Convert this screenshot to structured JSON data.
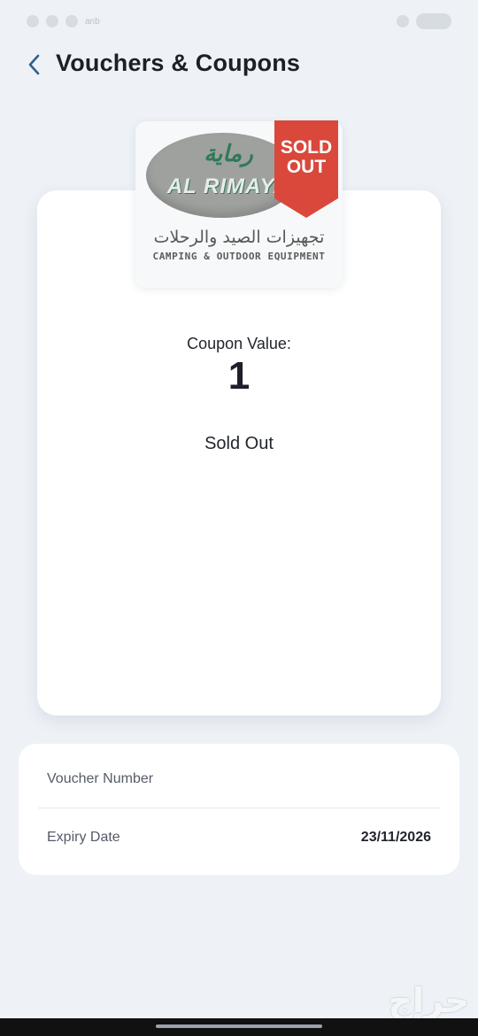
{
  "status_bar": {
    "carrier_label": "anb"
  },
  "header": {
    "title": "Vouchers & Coupons",
    "back_icon": "chevron-left-icon"
  },
  "logo": {
    "arabic_name": "رماية",
    "latin_name": "AL RIMAYA",
    "tagline_ar": "تجهيزات الصيد والرحلات",
    "tagline_en": "CAMPING & OUTDOOR EQUIPMENT"
  },
  "ribbon": {
    "line1": "SOLD",
    "line2": "OUT",
    "color": "#d9483b"
  },
  "coupon": {
    "value_label": "Coupon Value:",
    "value": "1",
    "status": "Sold Out"
  },
  "details": {
    "voucher_number_label": "Voucher Number",
    "voucher_number_value": "",
    "expiry_label": "Expiry Date",
    "expiry_value": "23/11/2026"
  },
  "watermark": {
    "text": "حراج"
  },
  "colors": {
    "background": "#eef2f7",
    "card": "#ffffff",
    "accent": "#2f5f8f"
  }
}
